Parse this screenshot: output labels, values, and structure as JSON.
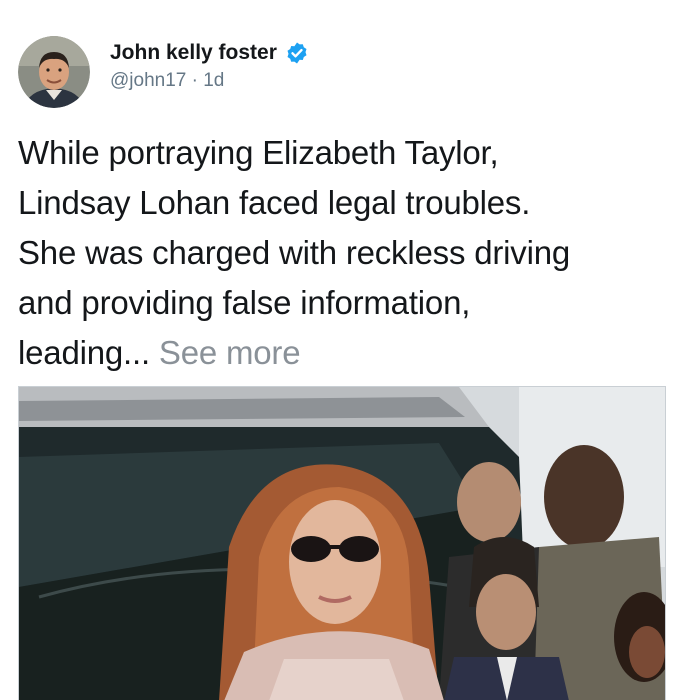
{
  "user": {
    "display_name": "John kelly foster",
    "handle": "@john17",
    "separator": " · ",
    "time": "1d",
    "verified": true,
    "avatar_icon": "profile-photo",
    "verified_icon": "verified-badge-icon"
  },
  "tweet": {
    "lines": [
      "While portraying Elizabeth Taylor,",
      "Lindsay Lohan faced legal troubles.",
      "She was charged with reckless driving",
      "and providing false information,"
    ],
    "last_line": "leading...",
    "see_more_label": "See more"
  },
  "media": {
    "type": "photo"
  },
  "colors": {
    "text": "#14171a",
    "secondary": "#657786",
    "see_more": "#8a9198",
    "verified": "#1da1f2"
  }
}
